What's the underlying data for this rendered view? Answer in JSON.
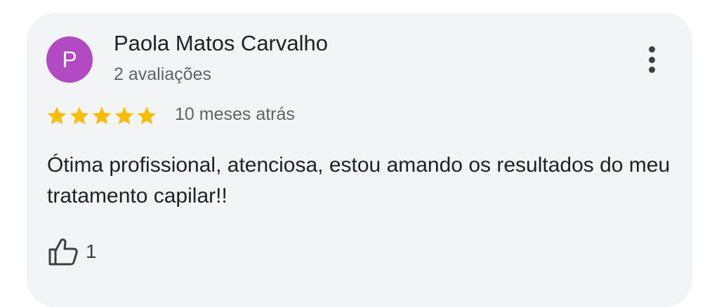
{
  "reviewer": {
    "avatar_letter": "P",
    "avatar_color": "#b24ac3",
    "name": "Paola Matos Carvalho",
    "review_count": "2 avaliações"
  },
  "review": {
    "rating": 5,
    "rating_max": 5,
    "star_color": "#fbbc04",
    "date": "10 meses atrás",
    "text": "Ótima profissional, atenciosa, estou amando os resultados do meu tratamento capilar!!",
    "likes": "1"
  },
  "icons": {
    "more": "more-vert-icon",
    "star": "star-icon",
    "like": "thumb-up-icon"
  }
}
